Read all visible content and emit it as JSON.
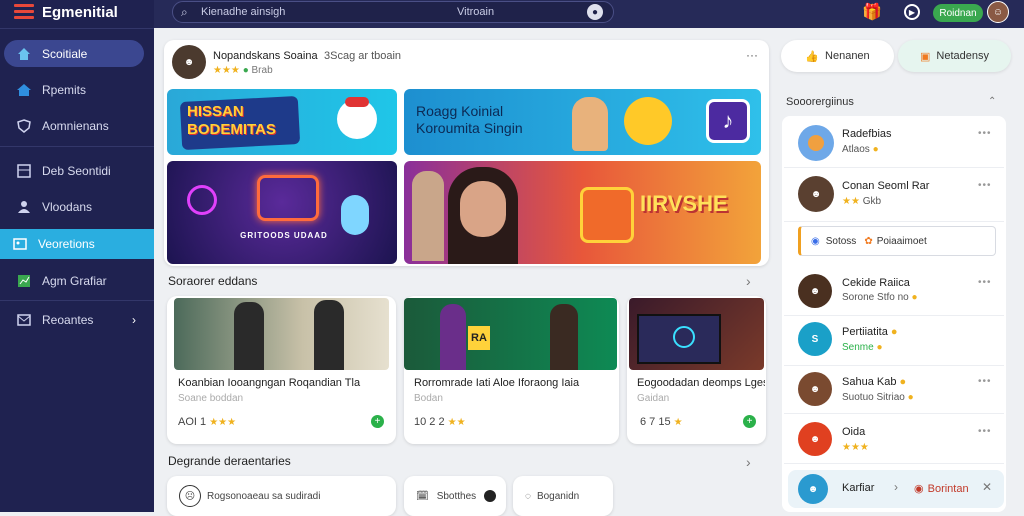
{
  "app": {
    "title": "Egmenitial"
  },
  "sidebar": {
    "items": [
      {
        "label": "Scoitiale"
      },
      {
        "label": "Rpemits"
      },
      {
        "label": "Aomnienans"
      },
      {
        "label": "Deb Seontidi"
      },
      {
        "label": "Vloodans"
      },
      {
        "label": "Veoretions"
      },
      {
        "label": "Agm Grafiar"
      },
      {
        "label": "Reoantes"
      }
    ]
  },
  "topbar": {
    "search_placeholder": "Kienadhe ainsigh",
    "search_scope": "Vitroain",
    "action_button": "Roidnan"
  },
  "feed": {
    "author": "Nopandskans Soaina",
    "author_meta": "3Scag ar tboain",
    "rating_label": "Brab",
    "banners": [
      {
        "text": "HISSAN BODEMITAS"
      },
      {
        "text": "Roagg Koinial Koroumita Singin"
      },
      {
        "text": "GRITOODS UDAAD"
      },
      {
        "text": "IIRVSHE"
      }
    ]
  },
  "section1": {
    "title": "Soraorer eddans",
    "videos": [
      {
        "title": "Koanbian Iooangngan Roqandian Tla",
        "subtitle": "Soane boddan",
        "meta": "AOI 1"
      },
      {
        "title": "Rorromrade Iati Aloe Iforaong Iaia",
        "subtitle": "Bodan",
        "meta": "10 2 2"
      },
      {
        "title": "Eogoodadan deomps Lgesi",
        "subtitle": "Gaidan",
        "meta": "6 7 15"
      }
    ],
    "thumb_badge": "RA"
  },
  "section2": {
    "title": "Degrande deraentaries",
    "buttons": [
      {
        "label": "Rogsonoaeau sa sudiradi"
      },
      {
        "label": "Sbotthes"
      },
      {
        "label": "Boganidn"
      }
    ]
  },
  "right_panel": {
    "pill_left": "Nenanen",
    "pill_right": "Netadensy",
    "header": "Sooorergiinus",
    "notify_label": "Sotoss",
    "notify_value": "Poiaaimoet",
    "items": [
      {
        "name": "Radefbias",
        "sub": "Atlaos"
      },
      {
        "name": "Conan Seoml Rar",
        "sub": "Gkb"
      },
      {
        "name": "Cekide Raiica",
        "sub": "Sorone Stfo no"
      },
      {
        "name": "Pertiiatita",
        "sub": "Senme"
      },
      {
        "name": "Sahua Kab",
        "sub": "Suotuo Sitriao"
      },
      {
        "name": "Oida",
        "sub": ""
      }
    ],
    "footer_name": "Karfiar",
    "footer_action": "Borintan"
  },
  "colors": {
    "sidebar": "#1f2250",
    "topbar": "#262a58",
    "accent_green": "#3aa84f",
    "highlight": "#2aaee0"
  }
}
